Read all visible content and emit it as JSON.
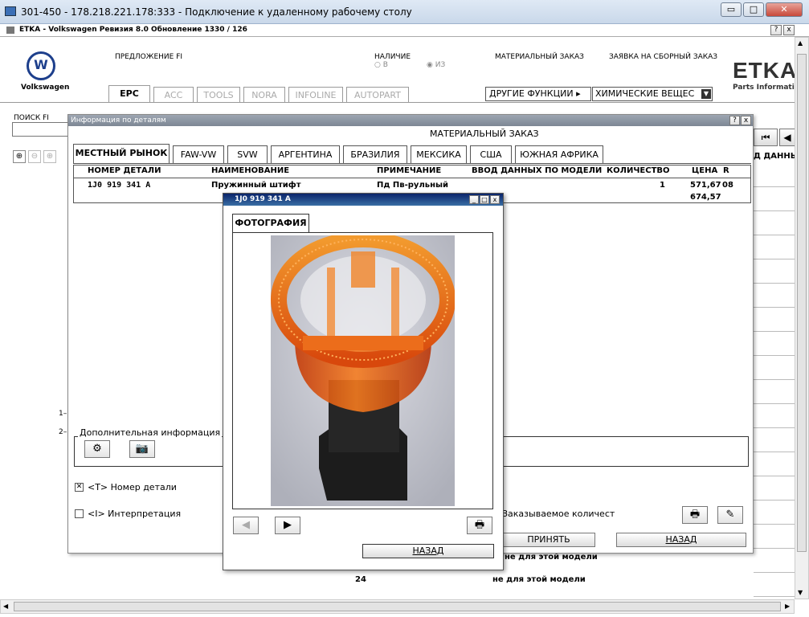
{
  "window": {
    "title": "301-450 - 178.218.221.178:333 - Подключение к удаленному рабочему столу",
    "minimize": "▭",
    "maximize": "□",
    "close": "✕"
  },
  "app": {
    "title": "ETKA - Volkswagen Ревизия 8.0 Обновление 1330 / 126",
    "help": "?",
    "close": "x"
  },
  "header": {
    "brand": "Volkswagen",
    "proposal": "ПРЕДЛОЖЕНИЕ FI",
    "availability": "НАЛИЧИЕ",
    "option_in": "В",
    "option_from": "ИЗ",
    "material_order": "МАТЕРИАЛЬНЫЙ ЗАКАЗ",
    "assembly_order": "ЗАЯВКА НА СБОРНЫЙ ЗАКАЗ",
    "etka_logo": "ETKA",
    "etka_sub": "Parts Informati",
    "other_functions": "ДРУГИЕ ФУНКЦИИ",
    "chem_select": "ХИМИЧЕСКИЕ ВЕЩЕС",
    "search_label": "ПОИСК FI",
    "right_partial": "Д ДАННЫХ"
  },
  "tabs": [
    "EPC",
    "ACC",
    "TOOLS",
    "NORA",
    "INFOLINE",
    "AUTOPART"
  ],
  "dialog": {
    "title": "Информация по деталям",
    "heading": "МАТЕРИАЛЬНЫЙ ЗАКАЗ",
    "help": "?",
    "close": "x",
    "market_tabs": [
      "МЕСТНЫЙ РЫНОК",
      "FAW-VW",
      "SVW",
      "АРГЕНТИНА",
      "БРАЗИЛИЯ",
      "МЕКСИКА",
      "США",
      "ЮЖНАЯ АФРИКА"
    ],
    "columns": [
      "НОМЕР ДЕТАЛИ",
      "НАИМЕНОВАНИЕ",
      "ПРИМЕЧАНИЕ",
      "ВВОД ДАННЫХ ПО МОДЕЛИ",
      "КОЛИЧЕСТВО",
      "ЦЕНА",
      "R"
    ],
    "row": {
      "part": "1J0 919 341 A",
      "name": "Пружинный штифт",
      "note": "Пд  Пв-рульный",
      "qty": "1",
      "price1": "571,67",
      "price2": "674,57",
      "r": "08"
    },
    "extra_info": "Дополнительная информация",
    "cb_part_number": "<T> Номер детали",
    "cb_interpretation": "<I> Интерпретация",
    "order_qty": "Заказываемое количест",
    "accept": "ПРИНЯТЬ",
    "back": "НАЗАД"
  },
  "popup": {
    "title": "1J0 919 341 A",
    "tab": "ФОТОГРАФИЯ",
    "back": "НАЗАД"
  },
  "background": {
    "row1": "1–",
    "row2": "2–",
    "not_for_model": "не для этой модели",
    "num24": "24"
  }
}
